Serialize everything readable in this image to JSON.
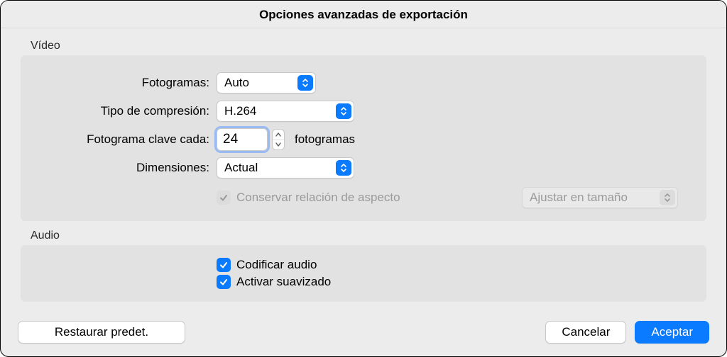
{
  "title": "Opciones avanzadas de exportación",
  "video": {
    "section_label": "Vídeo",
    "frames_label": "Fotogramas:",
    "frames_value": "Auto",
    "compression_label": "Tipo de compresión:",
    "compression_value": "H.264",
    "keyframe_label": "Fotograma clave cada:",
    "keyframe_value": "24",
    "keyframe_suffix": "fotogramas",
    "dimensions_label": "Dimensiones:",
    "dimensions_value": "Actual",
    "aspect_label": "Conservar relación de aspecto",
    "fit_value": "Ajustar en tamaño"
  },
  "audio": {
    "section_label": "Audio",
    "encode_label": "Codificar audio",
    "smooth_label": "Activar suavizado"
  },
  "buttons": {
    "restore": "Restaurar predet.",
    "cancel": "Cancelar",
    "ok": "Aceptar"
  }
}
